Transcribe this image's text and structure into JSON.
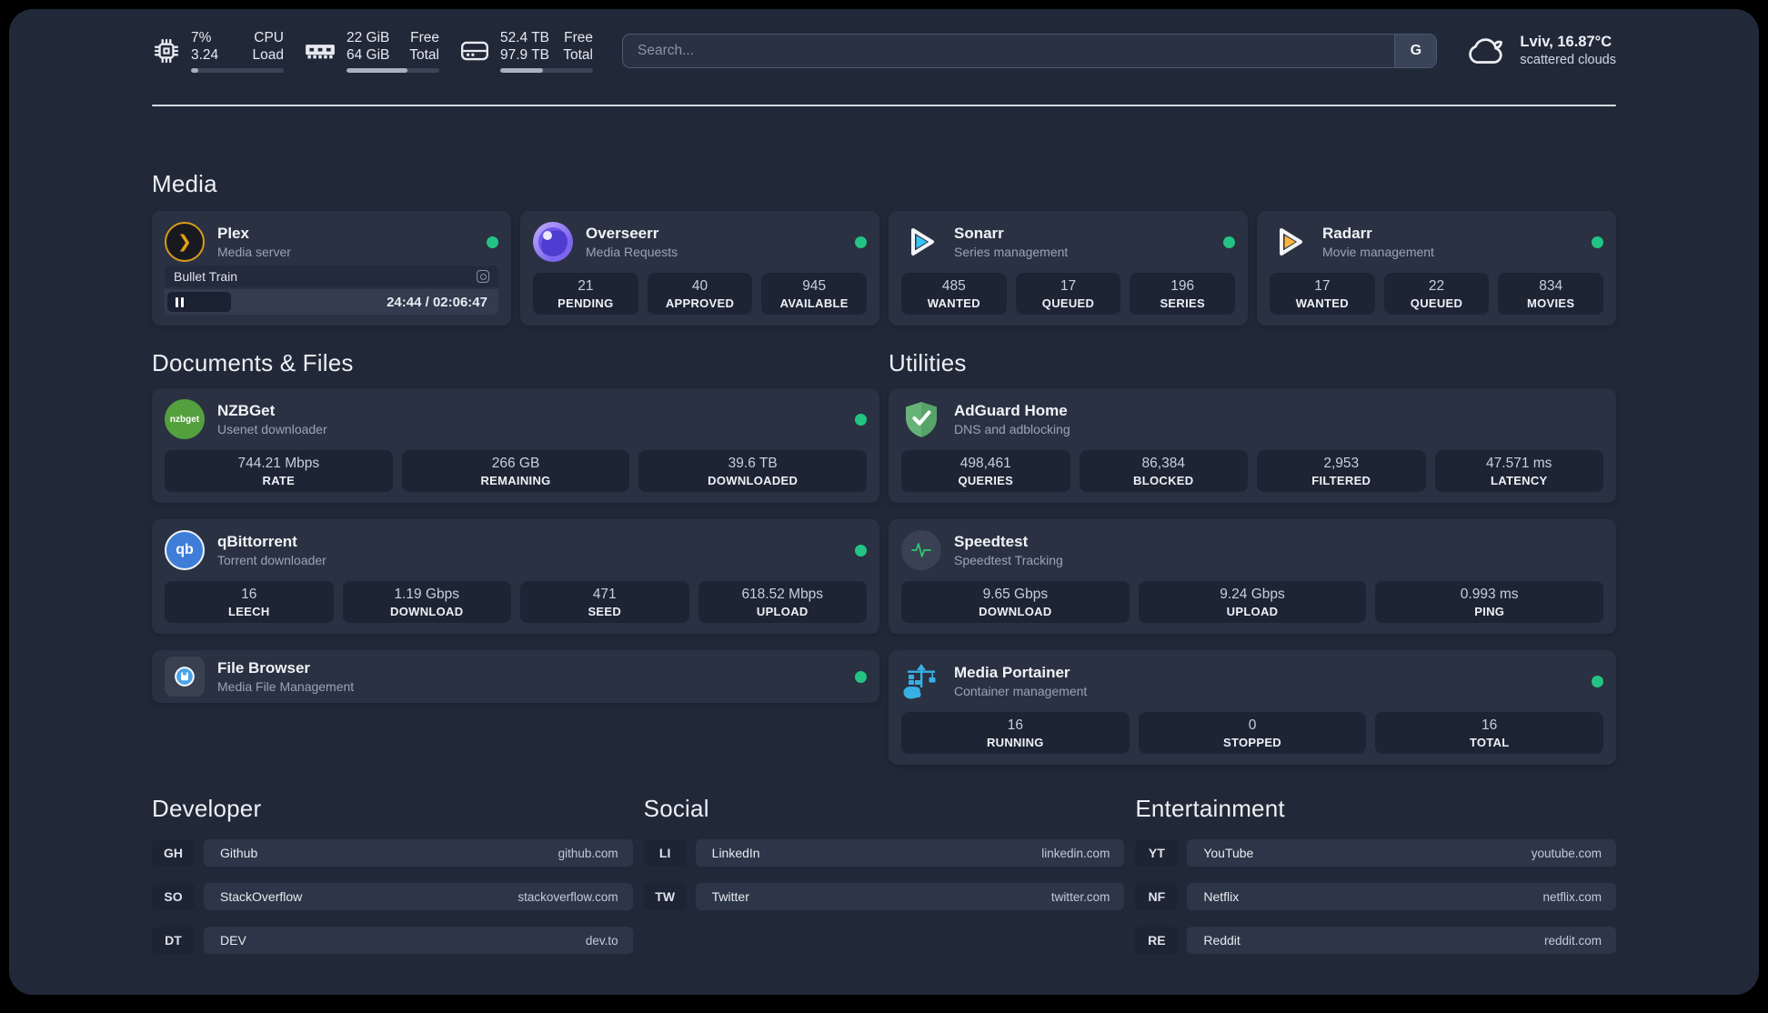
{
  "header": {
    "system": {
      "cpu": {
        "top_left": "7%",
        "bottom_left": "3.24",
        "top_right": "CPU",
        "bottom_right": "Load",
        "bar": 8
      },
      "memory": {
        "top_left": "22 GiB",
        "bottom_left": "64 GiB",
        "top_right": "Free",
        "bottom_right": "Total",
        "bar": 66
      },
      "storage": {
        "top_left": "52.4 TB",
        "bottom_left": "97.9 TB",
        "top_right": "Free",
        "bottom_right": "Total",
        "bar": 46
      }
    },
    "search": {
      "placeholder": "Search...",
      "button": "G"
    },
    "weather": {
      "location": "Lviv, 16.87°C",
      "condition": "scattered clouds"
    }
  },
  "media": {
    "title": "Media",
    "plex": {
      "name": "Plex",
      "subtitle": "Media server",
      "icon_glyph": "❯",
      "player": {
        "title": "Bullet Train",
        "time": "24:44 / 02:06:47",
        "progress": 19
      }
    },
    "overseerr": {
      "name": "Overseerr",
      "subtitle": "Media Requests",
      "stats": [
        {
          "value": "21",
          "label": "PENDING"
        },
        {
          "value": "40",
          "label": "APPROVED"
        },
        {
          "value": "945",
          "label": "AVAILABLE"
        }
      ]
    },
    "sonarr": {
      "name": "Sonarr",
      "subtitle": "Series management",
      "stats": [
        {
          "value": "485",
          "label": "WANTED"
        },
        {
          "value": "17",
          "label": "QUEUED"
        },
        {
          "value": "196",
          "label": "SERIES"
        }
      ]
    },
    "radarr": {
      "name": "Radarr",
      "subtitle": "Movie management",
      "stats": [
        {
          "value": "17",
          "label": "WANTED"
        },
        {
          "value": "22",
          "label": "QUEUED"
        },
        {
          "value": "834",
          "label": "MOVIES"
        }
      ]
    }
  },
  "documents": {
    "title": "Documents & Files",
    "nzbget": {
      "name": "NZBGet",
      "subtitle": "Usenet downloader",
      "icon_text": "nzbget",
      "stats": [
        {
          "value": "744.21 Mbps",
          "label": "RATE"
        },
        {
          "value": "266 GB",
          "label": "REMAINING"
        },
        {
          "value": "39.6 TB",
          "label": "DOWNLOADED"
        }
      ]
    },
    "qbittorrent": {
      "name": "qBittorrent",
      "subtitle": "Torrent downloader",
      "icon_text": "qb",
      "stats": [
        {
          "value": "16",
          "label": "LEECH"
        },
        {
          "value": "1.19 Gbps",
          "label": "DOWNLOAD"
        },
        {
          "value": "471",
          "label": "SEED"
        },
        {
          "value": "618.52 Mbps",
          "label": "UPLOAD"
        }
      ]
    },
    "filebrowser": {
      "name": "File Browser",
      "subtitle": "Media File Management"
    }
  },
  "utilities": {
    "title": "Utilities",
    "adguard": {
      "name": "AdGuard Home",
      "subtitle": "DNS and adblocking",
      "stats": [
        {
          "value": "498,461",
          "label": "QUERIES"
        },
        {
          "value": "86,384",
          "label": "BLOCKED"
        },
        {
          "value": "2,953",
          "label": "FILTERED"
        },
        {
          "value": "47.571 ms",
          "label": "LATENCY"
        }
      ]
    },
    "speedtest": {
      "name": "Speedtest",
      "subtitle": "Speedtest Tracking",
      "stats": [
        {
          "value": "9.65 Gbps",
          "label": "DOWNLOAD"
        },
        {
          "value": "9.24 Gbps",
          "label": "UPLOAD"
        },
        {
          "value": "0.993 ms",
          "label": "PING"
        }
      ]
    },
    "portainer": {
      "name": "Media Portainer",
      "subtitle": "Container management",
      "stats": [
        {
          "value": "16",
          "label": "RUNNING"
        },
        {
          "value": "0",
          "label": "STOPPED"
        },
        {
          "value": "16",
          "label": "TOTAL"
        }
      ]
    }
  },
  "bookmarks": {
    "developer": {
      "title": "Developer",
      "links": [
        {
          "tag": "GH",
          "name": "Github",
          "url": "github.com"
        },
        {
          "tag": "SO",
          "name": "StackOverflow",
          "url": "stackoverflow.com"
        },
        {
          "tag": "DT",
          "name": "DEV",
          "url": "dev.to"
        }
      ]
    },
    "social": {
      "title": "Social",
      "links": [
        {
          "tag": "LI",
          "name": "LinkedIn",
          "url": "linkedin.com"
        },
        {
          "tag": "TW",
          "name": "Twitter",
          "url": "twitter.com"
        }
      ]
    },
    "entertainment": {
      "title": "Entertainment",
      "links": [
        {
          "tag": "YT",
          "name": "YouTube",
          "url": "youtube.com"
        },
        {
          "tag": "NF",
          "name": "Netflix",
          "url": "netflix.com"
        },
        {
          "tag": "RE",
          "name": "Reddit",
          "url": "reddit.com"
        }
      ]
    }
  },
  "colors": {
    "status_online": "#23c483",
    "plex_accent": "#e5a00d",
    "overseerr_purple": "#7d66ee",
    "sonarr_cyan": "#35c5f4",
    "radarr_yellow": "#ffb53c",
    "nzbget_green": "#55a03e",
    "qbittorrent_blue": "#3e7ed8",
    "filebrowser_blue": "#4aa3e8",
    "adguard_green": "#67b279",
    "speedtest_pulse": "#2ecc71",
    "portainer_blue": "#38b0e3"
  }
}
